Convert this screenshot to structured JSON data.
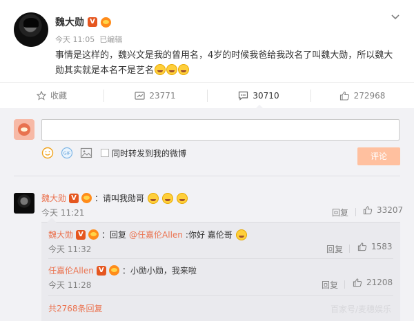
{
  "post": {
    "author": "魏大勋",
    "verified_badge": "V",
    "time": "今天 11:05",
    "edited": "已编辑",
    "text": "事情是这样的，魏兴文是我的曾用名，4岁的时候我爸给我改名了叫魏大勋，所以魏大勋其实就是本名不是艺名",
    "emoji_icons": [
      "laugh-cry-emoji",
      "laugh-cry-emoji",
      "laugh-cry-emoji"
    ]
  },
  "actions": {
    "favorite": "收藏",
    "repost_count": "23771",
    "comment_count": "30710",
    "like_count": "272968"
  },
  "composer": {
    "share_label": "同时转发到我的微博",
    "submit_label": "评论"
  },
  "comments": {
    "main": {
      "user": "魏大勋",
      "badge": "V",
      "text": "：请叫我勋哥",
      "time": "今天 11:21",
      "reply": "回复",
      "likes": "33207"
    },
    "sub": [
      {
        "user": "魏大勋",
        "badge": "V",
        "prefix": "：回复",
        "mention": "@任嘉伦Allen",
        "text": ":你好 嘉伦哥",
        "time": "今天 11:32",
        "reply": "回复",
        "likes": "1583"
      },
      {
        "user": "任嘉伦Allen",
        "badge": "V",
        "text": "：小勋小勋，我来啦",
        "time": "今天 11:28",
        "reply": "回复",
        "likes": "21208"
      }
    ],
    "more": "共2768条回复"
  },
  "watermark": "百家号/麦穗娱乐",
  "colors": {
    "accent": "#eb7350",
    "verified": "#e5561f",
    "submit_disabled": "#ffc09f"
  }
}
